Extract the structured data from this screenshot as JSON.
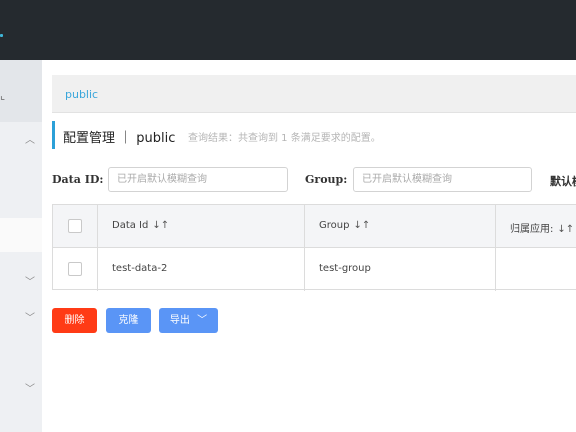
{
  "sidebar": {
    "top_mark": "⌞",
    "chevrons": [
      "chevron-up-icon",
      "chevron-down-icon",
      "chevron-down-icon",
      "chevron-down-icon"
    ]
  },
  "breadcrumb": {
    "namespace": "public"
  },
  "header": {
    "title": "配置管理 ｜ public",
    "result_summary": "查询结果：共查询到 1 条满足要求的配置。"
  },
  "filters": {
    "data_id_label": "Data ID:",
    "data_id_placeholder": "已开启默认模糊查询",
    "group_label": "Group:",
    "group_placeholder": "已开启默认模糊查询",
    "default_label_truncated": "默认模"
  },
  "table": {
    "columns": [
      {
        "label": "Data Id",
        "sort_icon": "↓↑"
      },
      {
        "label": "Group",
        "sort_icon": "↓↑"
      },
      {
        "label": "归属应用:",
        "sort_icon": "↓↑"
      }
    ],
    "rows": [
      {
        "data_id": "test-data-2",
        "group": "test-group",
        "app": ""
      }
    ]
  },
  "actions": {
    "delete_label": "删除",
    "clone_label": "克隆",
    "export_label": "导出"
  },
  "colors": {
    "topbar": "#252a2f",
    "accent": "#2ba0d8",
    "danger": "#ff3b16",
    "primary": "#5a95f6"
  }
}
